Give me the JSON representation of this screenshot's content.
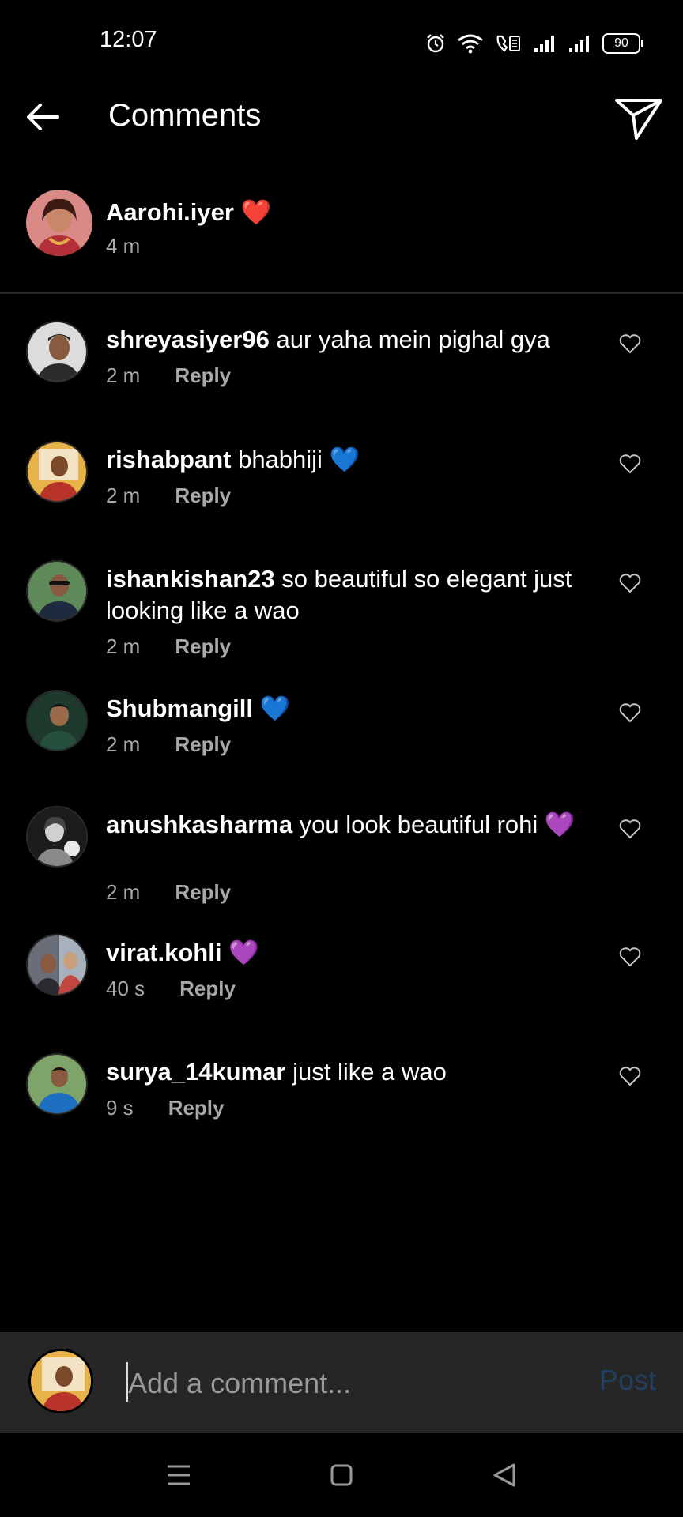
{
  "status_bar": {
    "time": "12:07",
    "battery": "90"
  },
  "header": {
    "title": "Comments"
  },
  "caption": {
    "username": "Aarohi.iyer",
    "emoji": "❤️",
    "time": "4 m"
  },
  "comments": [
    {
      "username": "shreyasiyer96",
      "text": " aur yaha mein pighal gya",
      "time": "2 m",
      "reply": "Reply"
    },
    {
      "username": "rishabpant",
      "text": " bhabhiji 💙",
      "time": "2 m",
      "reply": "Reply"
    },
    {
      "username": "ishankishan23",
      "text": " so beautiful so elegant just looking like a wao",
      "time": "2 m",
      "reply": "Reply"
    },
    {
      "username": "Shubmangill",
      "text": " 💙",
      "time": "2 m",
      "reply": "Reply"
    },
    {
      "username": "anushkasharma",
      "text": " you look beautiful rohi 💜",
      "time": "2 m",
      "reply": "Reply"
    },
    {
      "username": "virat.kohli",
      "text": " 💜",
      "time": "40 s",
      "reply": "Reply"
    },
    {
      "username": "surya_14kumar",
      "text": " just like a wao",
      "time": "9 s",
      "reply": "Reply"
    }
  ],
  "composer": {
    "placeholder": "Add a comment...",
    "post_label": "Post"
  },
  "colors": {
    "background": "#000000",
    "composer_bg": "#262626",
    "secondary_text": "#a8a8a8",
    "post_disabled": "#223f5f"
  }
}
